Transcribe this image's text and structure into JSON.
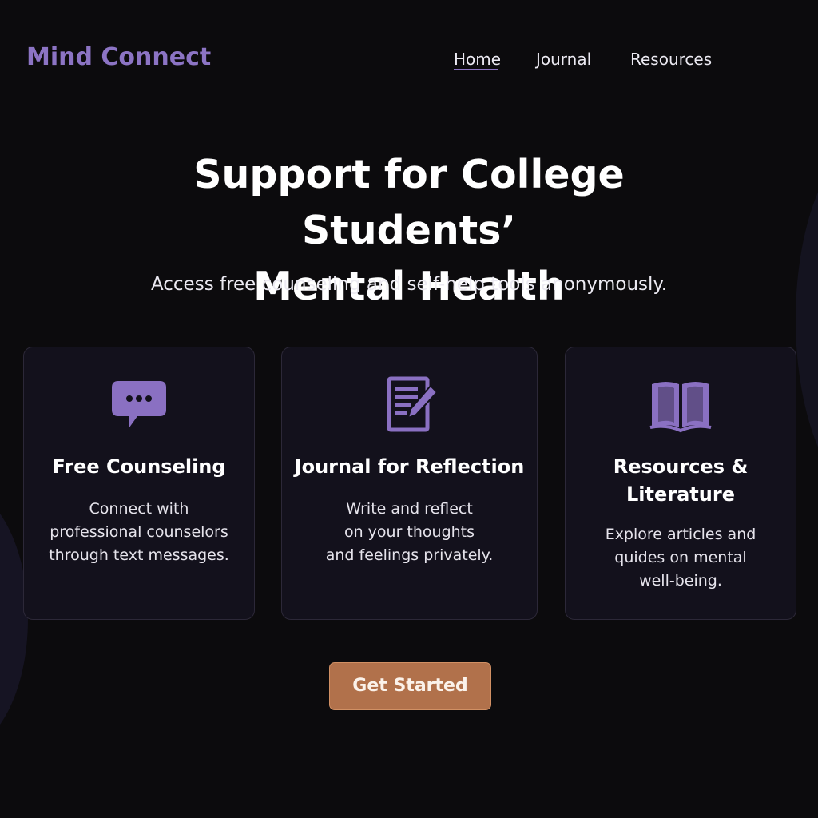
{
  "header": {
    "brand": "Mind Connect",
    "nav": [
      {
        "label": "Home",
        "active": true
      },
      {
        "label": "Journal",
        "active": false
      },
      {
        "label": "Resources",
        "active": false
      }
    ]
  },
  "hero": {
    "title_line1": "Support for College Students’",
    "title_line2": "Mental Health",
    "subtitle": "Access free counseling and self-help tools anonymously."
  },
  "cards": [
    {
      "icon": "chat-bubble-icon",
      "title": "Free Counseling",
      "desc_lines": [
        "Connect with",
        "professional counselors",
        "through text messages."
      ]
    },
    {
      "icon": "journal-pencil-icon",
      "title": "Journal for Reflection",
      "desc_lines": [
        "Write and reflect",
        "on your thoughts",
        "and feelings privately."
      ]
    },
    {
      "icon": "open-book-icon",
      "title_lines": [
        "Resources &",
        "Literature"
      ],
      "desc_lines": [
        "Explore articles and",
        "quides on mental",
        "well-being."
      ]
    }
  ],
  "cta": {
    "label": "Get Started"
  },
  "colors": {
    "background": "#0c0b0d",
    "accent": "#8c74c4",
    "card": "#13111c",
    "button": "#b1714b"
  }
}
